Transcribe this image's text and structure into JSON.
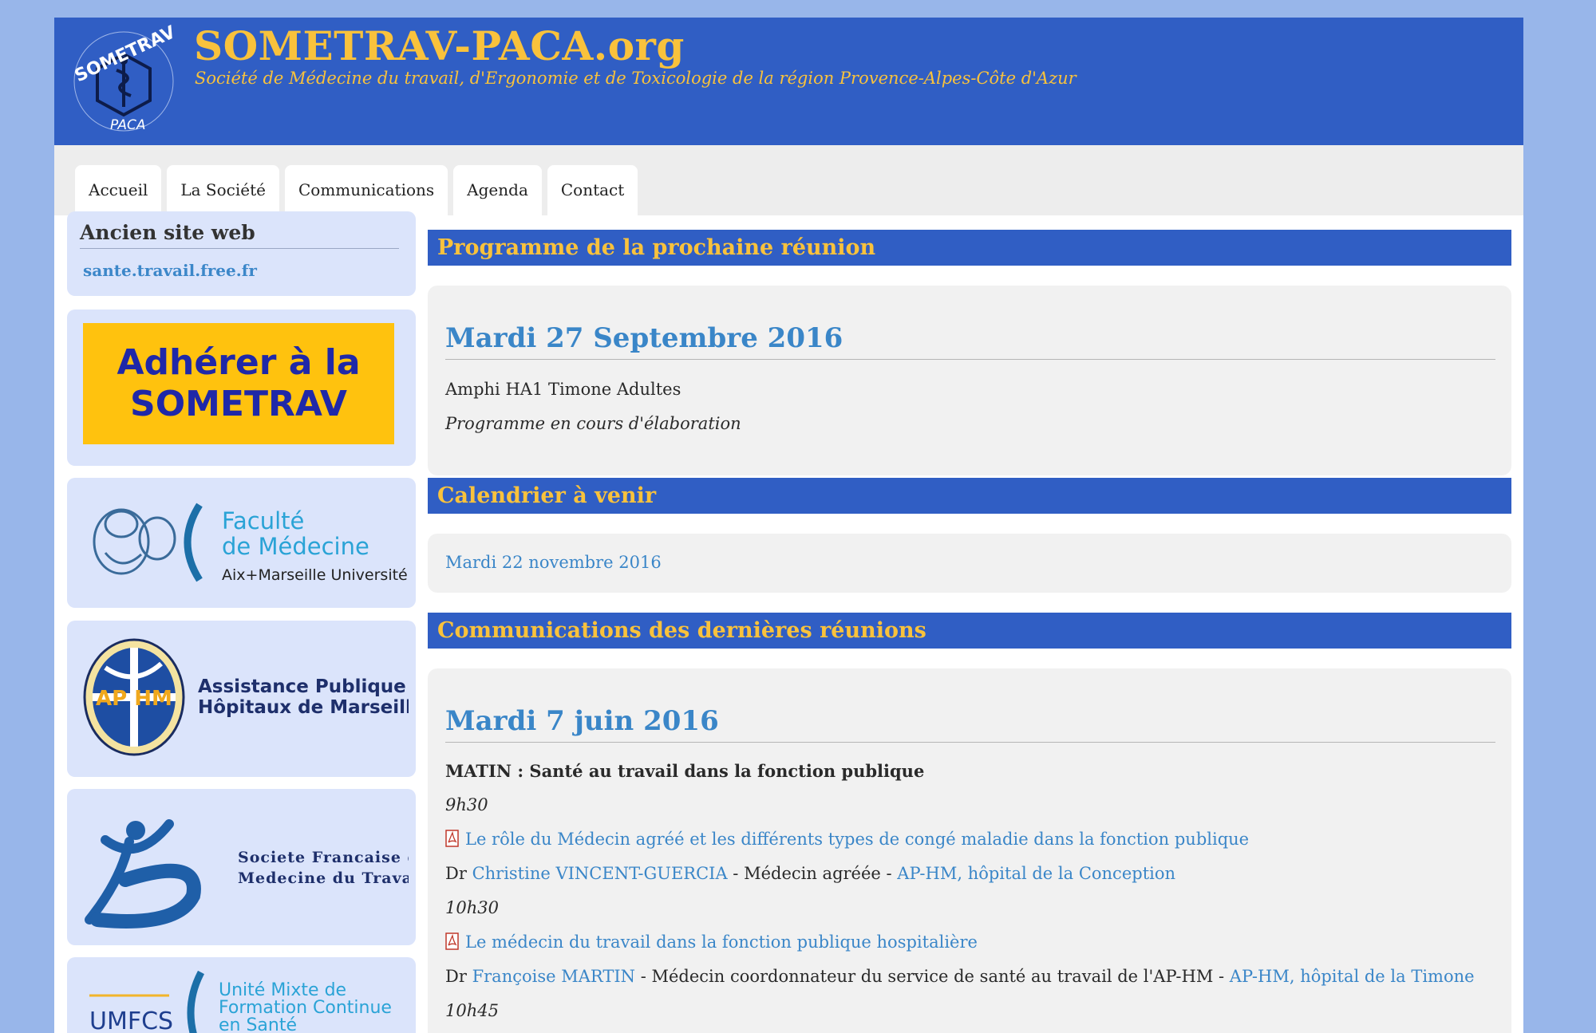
{
  "header": {
    "title": "SOMETRAV-PACA.org",
    "subtitle": "Société de Médecine du travail, d'Ergonomie et de Toxicologie de la région Provence-Alpes-Côte d'Azur",
    "logo_text_top": "SOMETRAV",
    "logo_text_bottom": "PACA"
  },
  "nav": {
    "items": [
      "Accueil",
      "La Société",
      "Communications",
      "Agenda",
      "Contact"
    ]
  },
  "sidebar": {
    "old_site_title": "Ancien site web",
    "old_site_link": "sante.travail.free.fr",
    "adhere_line1": "Adhérer à la",
    "adhere_line2": "SOMETRAV",
    "faculte_line1": "Faculté",
    "faculte_line2": "de Médecine",
    "faculte_line3": "Aix+Marseille Université",
    "aphm_badge": "AP HM",
    "aphm_line1": "Assistance Publique",
    "aphm_line2": "Hôpitaux de Marseille",
    "sfmt_line1": "Societe Francaise de",
    "sfmt_line2": "Medecine du Travail",
    "umfcs_acronym": "UMFCS",
    "umfcs_line1": "Unité Mixte de",
    "umfcs_line2": "Formation Continue",
    "umfcs_line3": "en Santé"
  },
  "main": {
    "next_meeting_header": "Programme de la prochaine réunion",
    "next_meeting_date": "Mardi 27 Septembre 2016",
    "next_meeting_place": "Amphi HA1 Timone Adultes",
    "next_meeting_note": "Programme en cours d'élaboration",
    "calendar_header": "Calendrier à venir",
    "calendar_item": "Mardi 22 novembre 2016",
    "past_header": "Communications des dernières réunions",
    "past_date": "Mardi 7 juin 2016",
    "morning_title": "MATIN : Santé au travail dans la fonction publique",
    "talks": [
      {
        "time": "9h30",
        "title": "Le rôle du Médecin agréé et les différents types de congé maladie dans la fonction publique",
        "prefix": "Dr ",
        "speaker": "Christine VINCENT-GUERCIA",
        "role": " - Médecin agréée - ",
        "place": "AP-HM, hôpital de la Conception"
      },
      {
        "time": "10h30",
        "title": "Le médecin du travail dans la fonction publique hospitalière",
        "prefix": "Dr ",
        "speaker": "Françoise MARTIN",
        "role": " - Médecin coordonnateur du service de santé au travail de l'AP-HM - ",
        "place": "AP-HM, hôpital de la Timone"
      }
    ],
    "next_time": "10h45"
  },
  "colors": {
    "banner_blue": "#305ec4",
    "title_gold": "#f9c23c",
    "link_blue": "#3a86c8",
    "page_bg": "#98b6ea"
  }
}
